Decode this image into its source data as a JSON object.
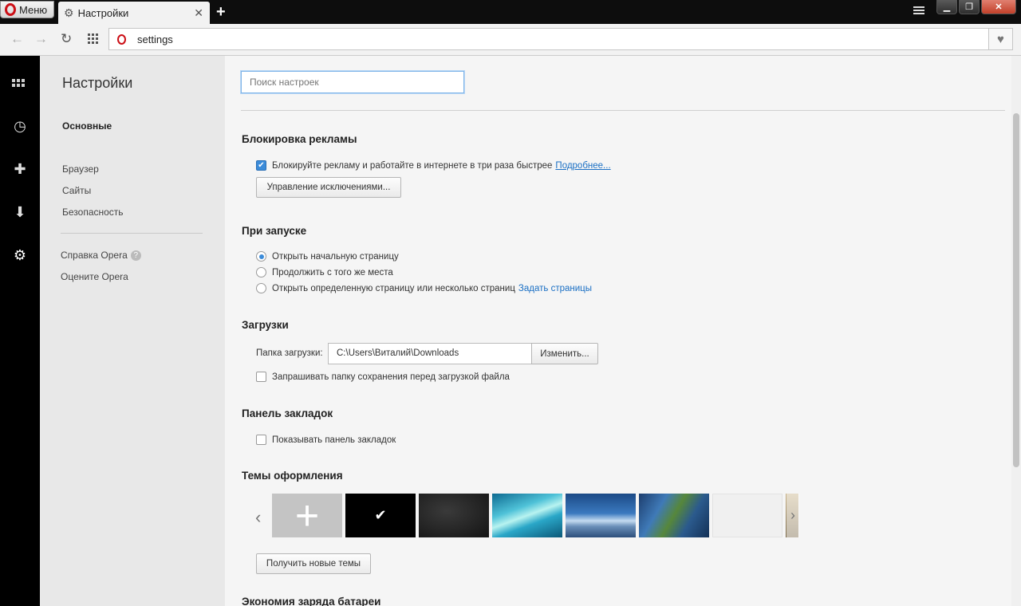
{
  "browser": {
    "menu_label": "Меню",
    "tab_title": "Настройки",
    "url": "settings"
  },
  "sidebar_icons": [
    "speed-dial-icon",
    "history-icon",
    "extensions-icon",
    "downloads-icon",
    "settings-icon"
  ],
  "settings_nav": {
    "title": "Настройки",
    "items": [
      {
        "label": "Основные",
        "active": true
      },
      {
        "label": "Браузер",
        "active": false
      },
      {
        "label": "Сайты",
        "active": false
      },
      {
        "label": "Безопасность",
        "active": false
      }
    ],
    "links": [
      {
        "label": "Справка Opera"
      },
      {
        "label": "Оцените Opera"
      }
    ]
  },
  "main": {
    "search_placeholder": "Поиск настроек",
    "adblock": {
      "title": "Блокировка рекламы",
      "checkbox_label": "Блокируйте рекламу и работайте в интернете в три раза быстрее",
      "checkbox_checked": true,
      "more_link": "Подробнее...",
      "exceptions_button": "Управление исключениями..."
    },
    "startup": {
      "title": "При запуске",
      "options": [
        {
          "label": "Открыть начальную страницу",
          "selected": true
        },
        {
          "label": "Продолжить с того же места",
          "selected": false
        },
        {
          "label": "Открыть определенную страницу или несколько страниц",
          "selected": false
        }
      ],
      "set_pages_link": "Задать страницы"
    },
    "downloads": {
      "title": "Загрузки",
      "folder_label": "Папка загрузки:",
      "folder_path": "C:\\Users\\Виталий\\Downloads",
      "change_button": "Изменить...",
      "ask_label": "Запрашивать папку сохранения перед загрузкой файла",
      "ask_checked": false
    },
    "bookmarks_bar": {
      "title": "Панель закладок",
      "show_label": "Показывать панель закладок",
      "show_checked": false
    },
    "themes": {
      "title": "Темы оформления",
      "get_button": "Получить новые темы"
    },
    "battery": {
      "title": "Экономия заряда батареи"
    }
  },
  "colors": {
    "accent": "#3b8bd9",
    "link": "#1a6fc4",
    "opera_red": "#cc0f16"
  }
}
